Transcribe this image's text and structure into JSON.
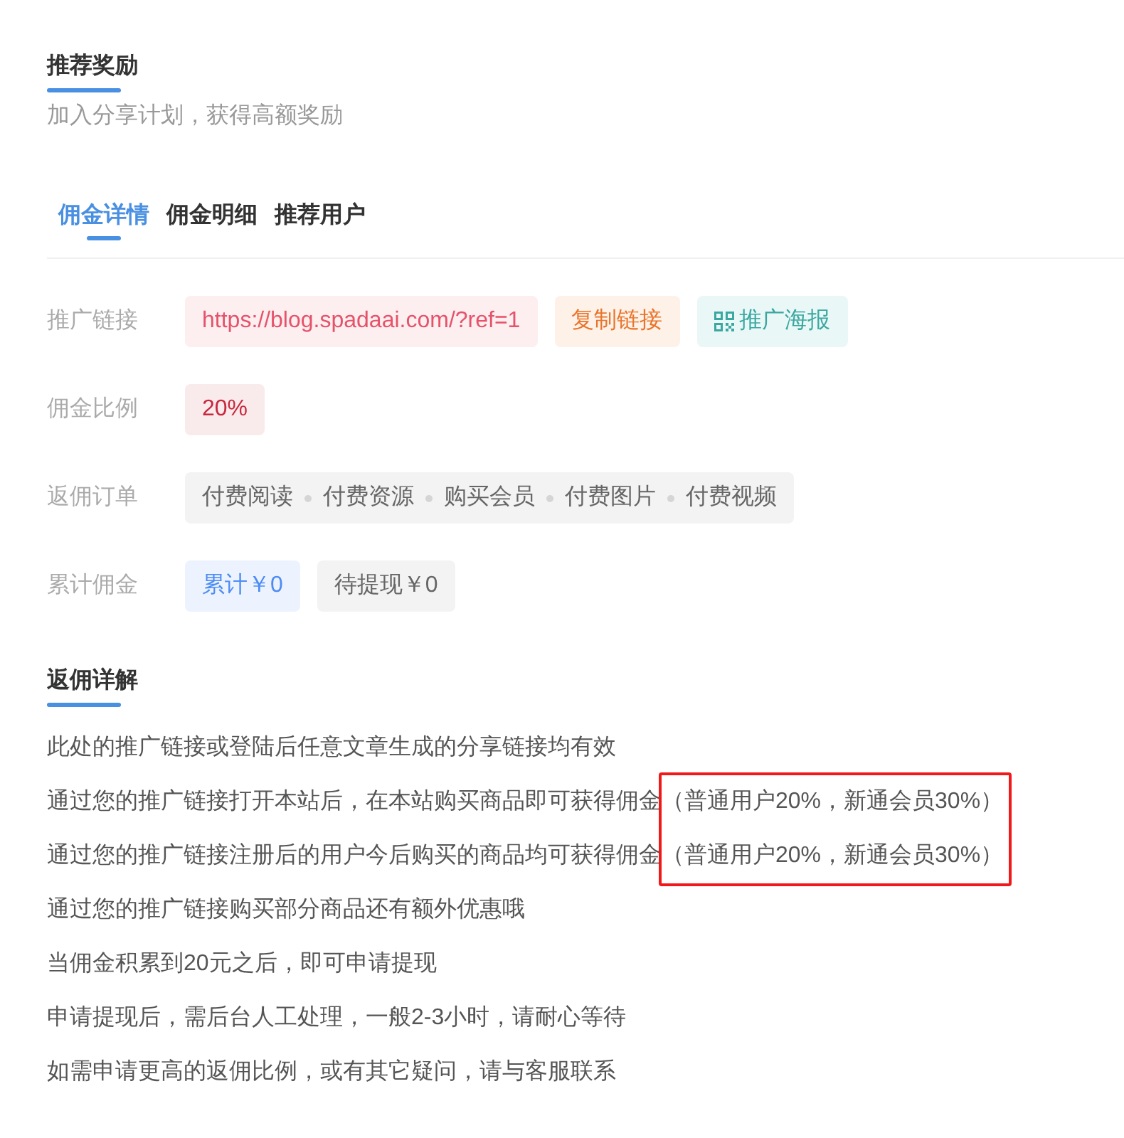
{
  "header": {
    "title": "推荐奖励",
    "subtitle": "加入分享计划，获得高额奖励"
  },
  "tabs": [
    {
      "label": "佣金详情",
      "selected": true
    },
    {
      "label": "佣金明细",
      "selected": false
    },
    {
      "label": "推荐用户",
      "selected": false
    }
  ],
  "fields": [
    {
      "label": "推广链接",
      "chips": [
        {
          "kind": "link",
          "text": "https://blog.spadaai.com/?ref=1"
        },
        {
          "kind": "copy",
          "text": "复制链接"
        },
        {
          "kind": "poster",
          "text": "推广海报"
        }
      ]
    },
    {
      "label": "佣金比例",
      "chips": [
        {
          "kind": "rate",
          "text": "20%"
        }
      ]
    },
    {
      "label": "返佣订单",
      "chips": [
        {
          "kind": "list",
          "items": [
            "付费阅读",
            "付费资源",
            "购买会员",
            "付费图片",
            "付费视频"
          ]
        }
      ]
    },
    {
      "label": "累计佣金",
      "chips": [
        {
          "kind": "total",
          "text": "累计￥0"
        },
        {
          "kind": "pending",
          "text": "待提现￥0"
        }
      ]
    }
  ],
  "details": {
    "title": "返佣详解",
    "lines": [
      {
        "text": "此处的推广链接或登陆后任意文章生成的分享链接均有效"
      },
      {
        "text": "通过您的推广链接打开本站后，在本站购买商品即可获得佣金",
        "note": "（普通用户20%，新通会员30%）"
      },
      {
        "text": "通过您的推广链接注册后的用户今后购买的商品均可获得佣金",
        "note": "（普通用户20%，新通会员30%）"
      },
      {
        "text": "通过您的推广链接购买部分商品还有额外优惠哦"
      },
      {
        "text": "当佣金积累到20元之后，即可申请提现"
      },
      {
        "text": "申请提现后，需后台人工处理，一般2-3小时，请耐心等待"
      },
      {
        "text": "如需申请更高的返佣比例，或有其它疑问，请与客服联系"
      }
    ]
  }
}
